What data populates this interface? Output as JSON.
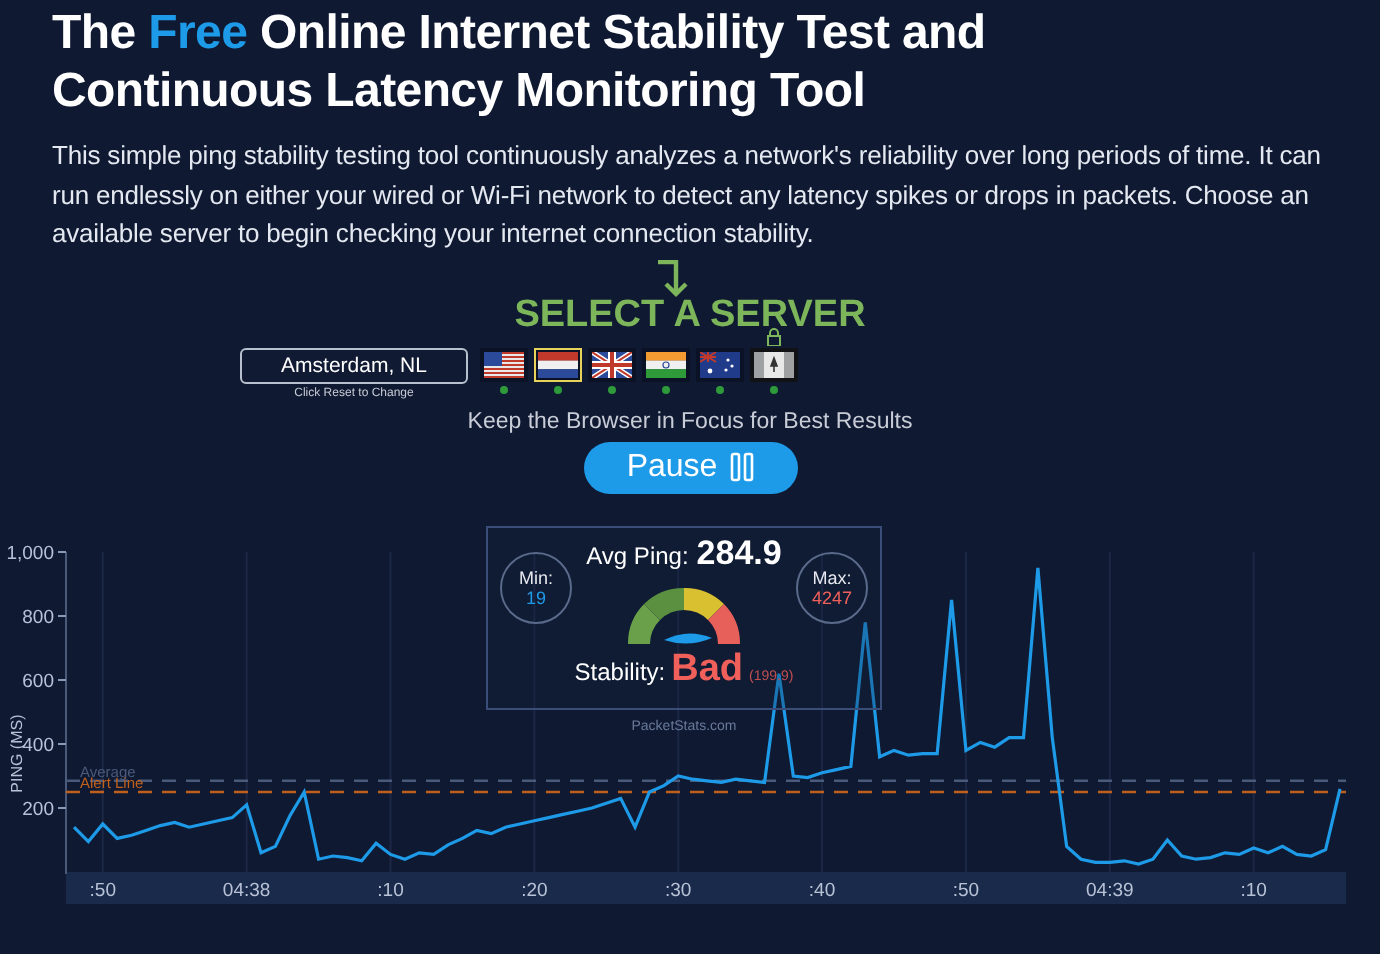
{
  "title": {
    "before": "The",
    "highlight": "Free",
    "after": "Online Internet Stability Test and Continuous Latency Monitoring Tool"
  },
  "intro": "This simple ping stability testing tool continuously analyzes a network's reliability over long periods of time. It can run endlessly on either your wired or Wi-Fi network to detect any latency spikes or drops in packets. Choose an available server to begin checking your internet connection stability.",
  "server_picker": {
    "heading": "SELECT A SERVER",
    "value": "Amsterdam, NL",
    "hint": "Click Reset to Change",
    "servers": [
      {
        "kind": "us",
        "selected": false,
        "locked": false
      },
      {
        "kind": "nl",
        "selected": true,
        "locked": false
      },
      {
        "kind": "uk",
        "selected": false,
        "locked": false
      },
      {
        "kind": "in",
        "selected": false,
        "locked": false
      },
      {
        "kind": "au",
        "selected": false,
        "locked": false
      },
      {
        "kind": "ca",
        "selected": false,
        "locked": true
      }
    ]
  },
  "focus_note": "Keep the Browser in Focus for Best Results",
  "pause_button": "Pause",
  "stats": {
    "min_label": "Min:",
    "min": "19",
    "avg_label": "Avg Ping:",
    "avg": "284.9",
    "max_label": "Max:",
    "max": "4247",
    "stability_label": "Stability:",
    "stability": "Bad",
    "stability_score": "(199.9)",
    "credit": "PacketStats.com"
  },
  "chart_data": {
    "type": "line",
    "ylabel": "PING (MS)",
    "ylim": [
      0,
      1000
    ],
    "yticks": [
      {
        "value": 200,
        "label": "200"
      },
      {
        "value": 400,
        "label": "400"
      },
      {
        "value": 600,
        "label": "600"
      },
      {
        "value": 800,
        "label": "800"
      },
      {
        "value": 1000,
        "label": "1,000"
      }
    ],
    "categories": [
      null,
      null,
      ":50",
      null,
      null,
      null,
      null,
      null,
      null,
      null,
      null,
      null,
      "04:38",
      null,
      null,
      null,
      null,
      null,
      null,
      null,
      null,
      null,
      ":10",
      null,
      null,
      null,
      null,
      null,
      null,
      null,
      null,
      null,
      ":20",
      null,
      null,
      null,
      null,
      null,
      null,
      null,
      null,
      null,
      ":30",
      null,
      null,
      null,
      null,
      null,
      null,
      null,
      null,
      null,
      ":40",
      null,
      null,
      null,
      null,
      null,
      null,
      null,
      null,
      null,
      ":50",
      null,
      null,
      null,
      null,
      null,
      null,
      null,
      null,
      null,
      "04:39",
      null,
      null,
      null,
      null,
      null,
      null,
      null,
      null,
      null,
      ":10",
      null,
      null,
      null,
      null,
      null,
      null
    ],
    "series": [
      {
        "color": "#1e9be8",
        "values": [
          140,
          95,
          150,
          105,
          115,
          130,
          145,
          155,
          140,
          150,
          160,
          170,
          210,
          60,
          80,
          175,
          250,
          40,
          50,
          45,
          35,
          90,
          55,
          40,
          60,
          55,
          85,
          105,
          130,
          120,
          140,
          150,
          160,
          170,
          180,
          190,
          200,
          215,
          230,
          140,
          250,
          270,
          300,
          290,
          285,
          280,
          290,
          285,
          280,
          620,
          300,
          295,
          310,
          320,
          330,
          780,
          360,
          380,
          365,
          370,
          370,
          850,
          380,
          405,
          390,
          420,
          420,
          950,
          420,
          80,
          40,
          30,
          30,
          35,
          25,
          40,
          100,
          50,
          40,
          45,
          60,
          55,
          75,
          60,
          80,
          55,
          50,
          70,
          260
        ]
      }
    ],
    "grid": true,
    "ref_lines": [
      {
        "axis": "y",
        "value": 285,
        "label": "Average"
      },
      {
        "axis": "y",
        "value": 250,
        "label": "Alert Line"
      }
    ]
  }
}
